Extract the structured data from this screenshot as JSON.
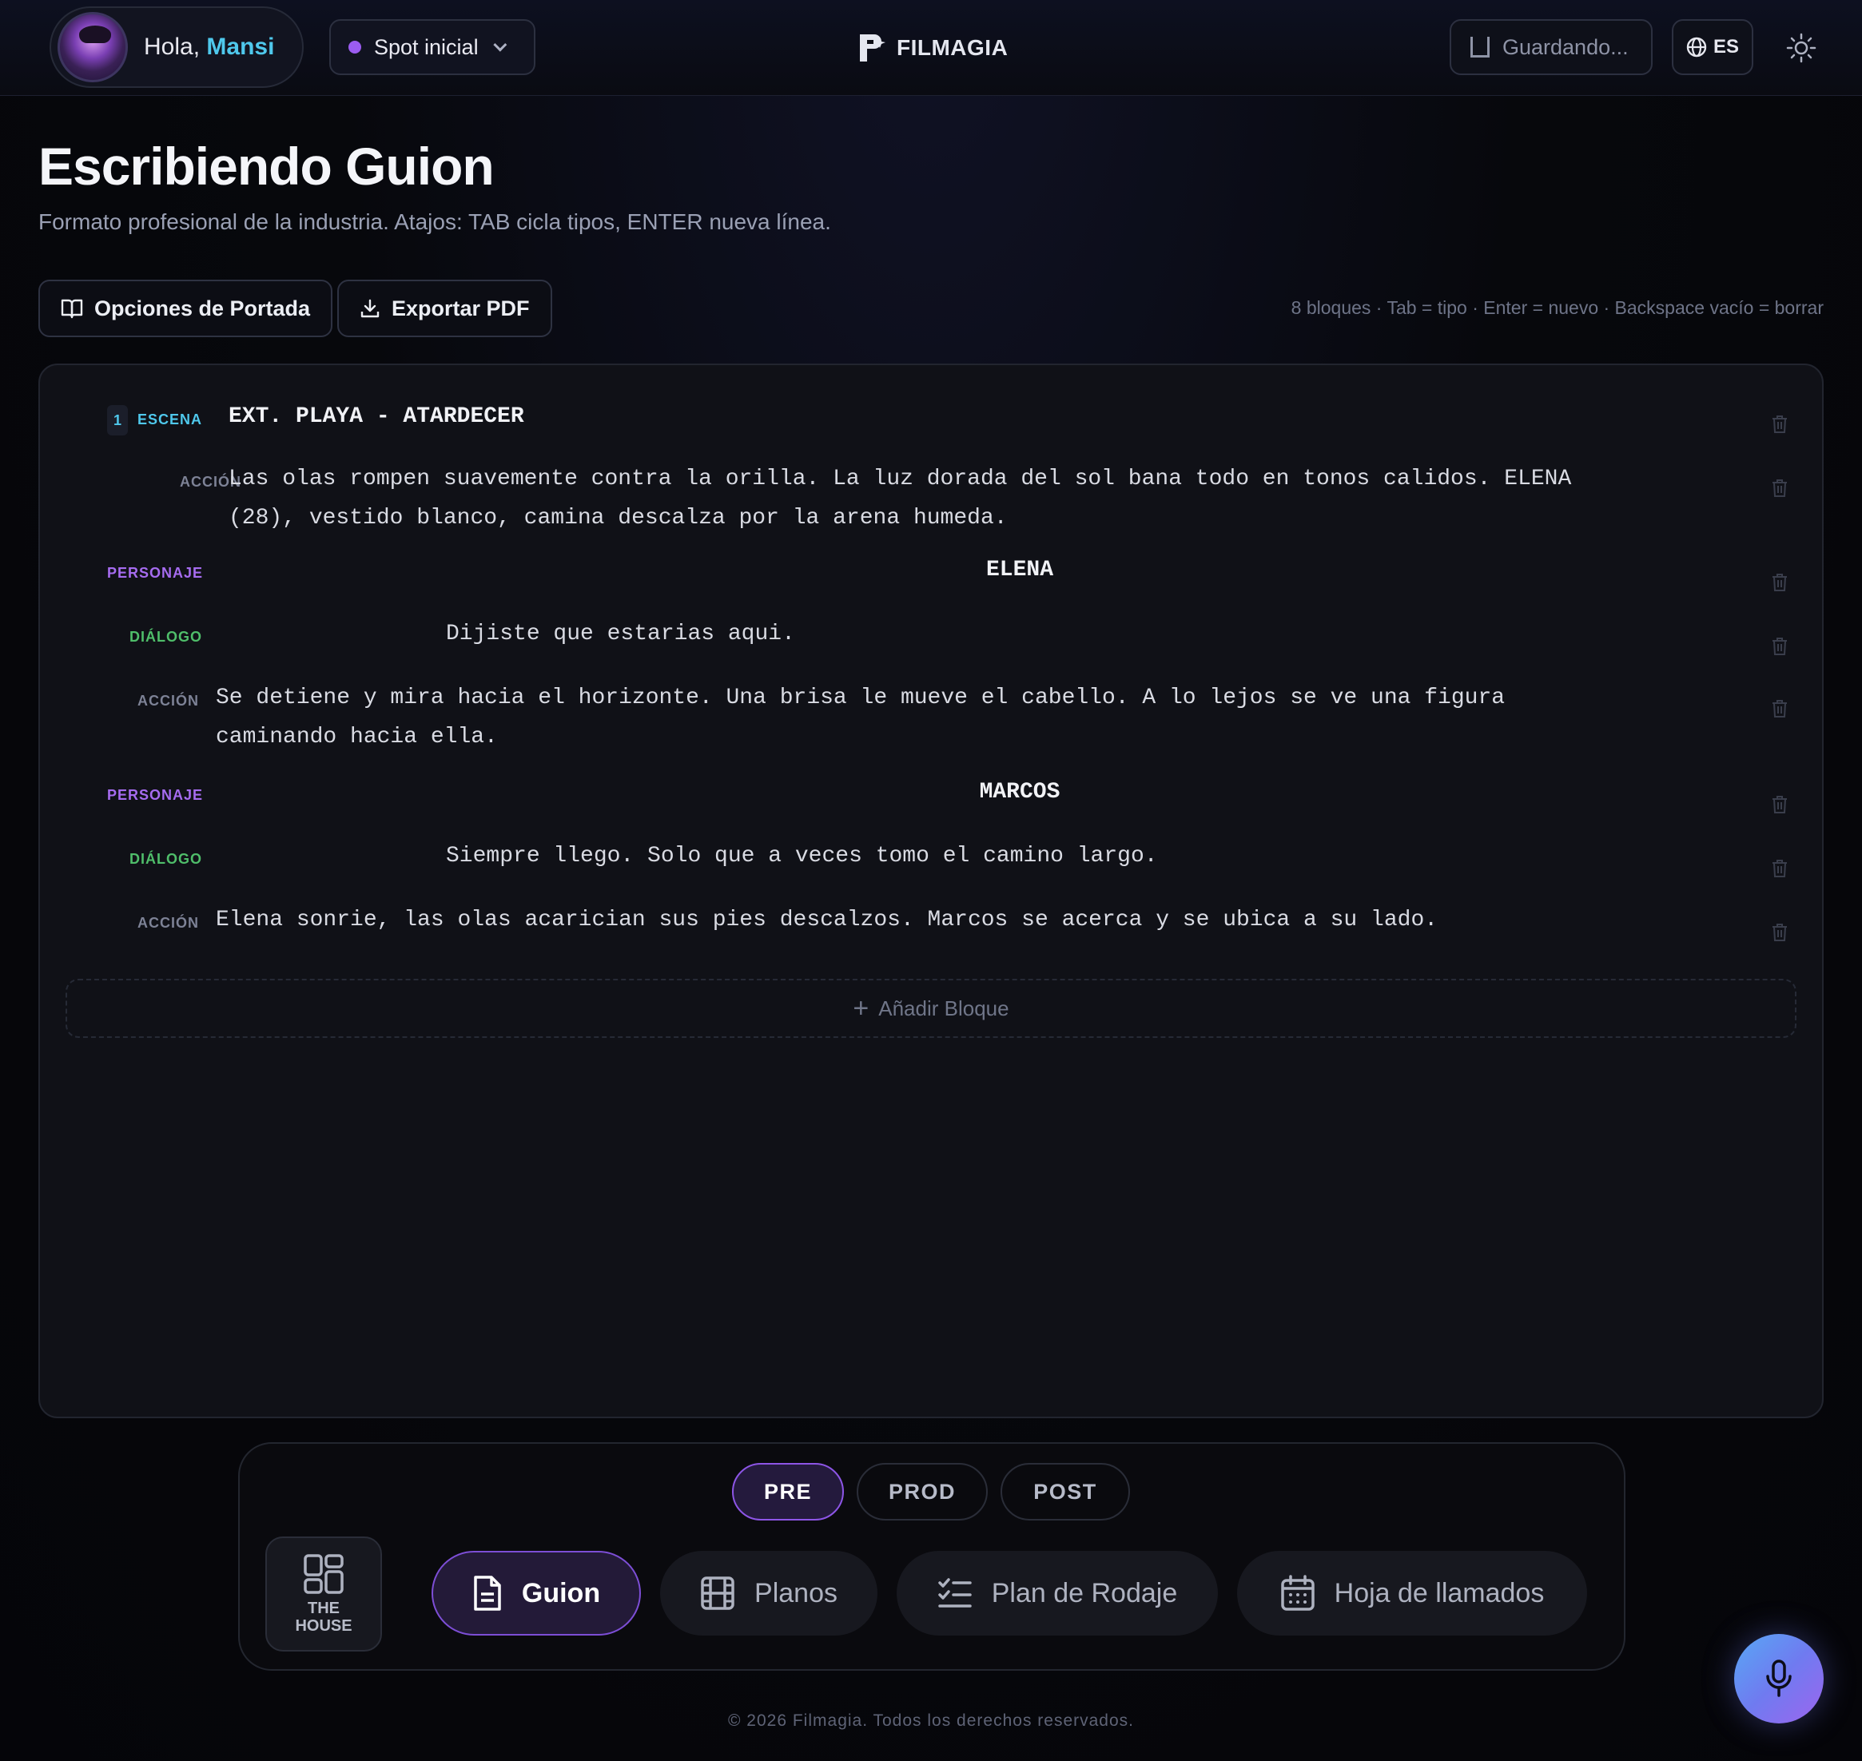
{
  "header": {
    "greeting": "Hola,",
    "user_name": "Mansi",
    "project": "Spot inicial",
    "brand": "FILMAGIA",
    "save_status": "Guardando...",
    "language": "ES"
  },
  "page": {
    "title": "Escribiendo Guion",
    "subtitle": "Formato profesional de la industria. Atajos: TAB cicla tipos, ENTER nueva línea.",
    "cover_options_label": "Opciones de Portada",
    "export_label": "Exportar PDF",
    "hint": "8 bloques · Tab = tipo · Enter = nuevo · Backspace vacío = borrar"
  },
  "colors": {
    "scene": "#4fc8ec",
    "action": "#7d8296",
    "character": "#a66cf0",
    "dialogue": "#4fbe6a",
    "accent": "#8d55e6"
  },
  "script": {
    "blocks": [
      {
        "number": "1",
        "type": "ESCENA",
        "lines": [
          "EXT. PLAYA - ATARDECER"
        ]
      },
      {
        "type": "ACCIÓN",
        "lines": [
          "Las olas rompen suavemente contra la orilla. La luz dorada del sol bana todo en tonos calidos. ELENA",
          "(28), vestido blanco, camina descalza por la arena humeda."
        ]
      },
      {
        "type": "PERSONAJE",
        "lines": [
          "ELENA"
        ]
      },
      {
        "type": "DIÁLOGO",
        "lines": [
          "Dijiste que estarias aqui."
        ]
      },
      {
        "type": "ACCIÓN",
        "lines": [
          "Se detiene y mira hacia el horizonte. Una brisa le mueve el cabello. A lo lejos se ve una figura",
          "caminando hacia ella."
        ]
      },
      {
        "type": "PERSONAJE",
        "lines": [
          "MARCOS"
        ]
      },
      {
        "type": "DIÁLOGO",
        "lines": [
          "Siempre llego. Solo que a veces tomo el camino largo."
        ]
      },
      {
        "type": "ACCIÓN",
        "lines": [
          "Elena sonrie, las olas acarician sus pies descalzos. Marcos se acerca y se ubica a su lado."
        ]
      }
    ],
    "add_block_label": "Añadir Bloque"
  },
  "nav": {
    "phases": [
      "PRE",
      "PROD",
      "POST"
    ],
    "active_phase": "PRE",
    "house_label_1": "THE",
    "house_label_2": "HOUSE",
    "tabs": [
      "Guion",
      "Planos",
      "Plan de Rodaje",
      "Hoja de llamados"
    ],
    "active_tab": "Guion"
  },
  "icons": {
    "user": "avatar",
    "project": "purple-dot",
    "chevron": "chevron-down-icon",
    "brand": "filmagia-logo",
    "save": "bookmark-icon",
    "lang": "globe-icon",
    "theme": "sun-icon",
    "cover": "book-open-icon",
    "export": "download-icon",
    "delete": "trash-icon",
    "house": "grid-icon",
    "guion": "file-text-icon",
    "planos": "film-icon",
    "plan": "list-checks-icon",
    "hoja": "calendar-icon",
    "mic": "mic-icon"
  },
  "footer": "© 2026 Filmagia. Todos los derechos reservados."
}
